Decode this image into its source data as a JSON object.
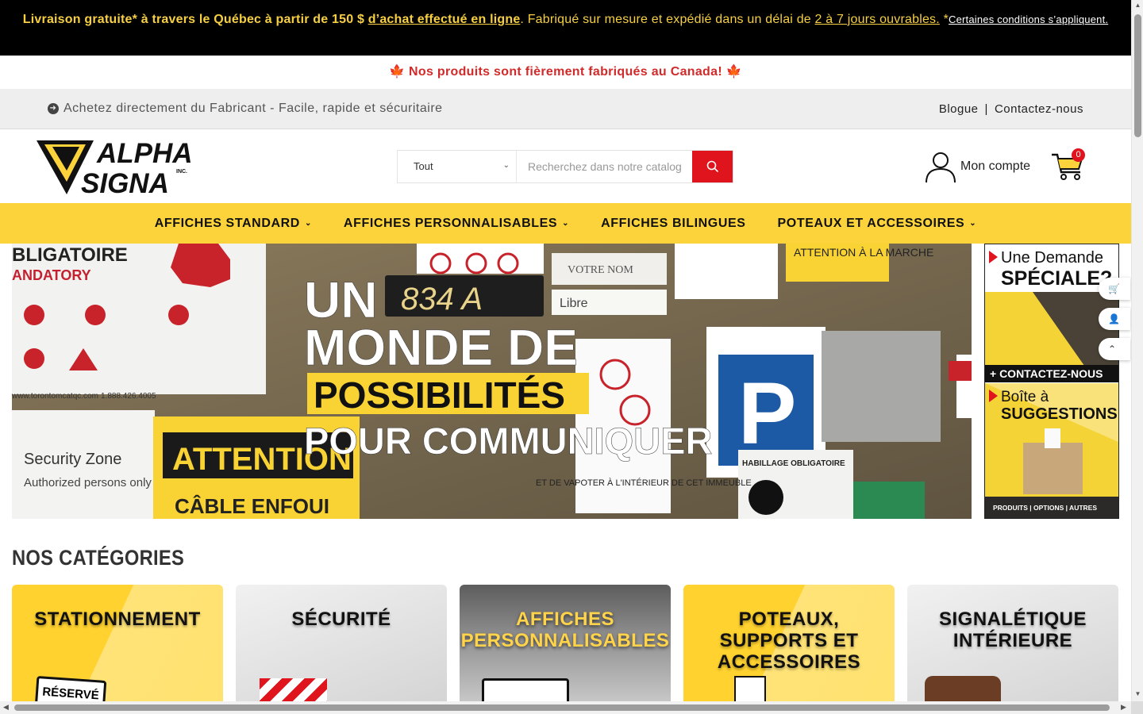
{
  "promo": {
    "part1": "Livraison gratuite* à travers le Québec à partir de 150 $ ",
    "link1": "d’achat effectué en ligne",
    "part2": ". Fabriqué sur mesure et expédié dans un délai de ",
    "link2": "2 à 7 jours ouvrables.",
    "part3": " *",
    "conditions": "Certaines conditions s’appliquent."
  },
  "canada_banner": "🍁 Nos produits sont fièrement fabriqués au Canada! 🍁",
  "utility": {
    "tagline": "Achetez directement du Fabricant - Facile, rapide et sécuritaire",
    "blog": "Blogue",
    "separator": "|",
    "contact": "Contactez-nous"
  },
  "header": {
    "logo_line1": "ALPHA",
    "logo_line2": "SIGNA",
    "logo_inc": "INC.",
    "search_category": "Tout",
    "search_placeholder": "Recherchez dans notre catalogue",
    "account_label": "Mon compte",
    "cart_count": "0"
  },
  "nav": [
    {
      "label": "AFFICHES STANDARD",
      "dropdown": true
    },
    {
      "label": "AFFICHES PERSONNALISABLES",
      "dropdown": true
    },
    {
      "label": "AFFICHES BILINGUES",
      "dropdown": false
    },
    {
      "label": "POTEAUX ET ACCESSOIRES",
      "dropdown": true
    }
  ],
  "hero": {
    "line1": "UN",
    "line2": "MONDE DE",
    "line3": "POSSIBILITÉS",
    "line4": "POUR COMMUNIQUER",
    "bg_left_title": "BLIGATOIRE",
    "bg_left_sub": "ANDATORY",
    "bg_plate": "834 A",
    "bg_name": "VOTRE NOM",
    "bg_libre": "Libre",
    "bg_attention": "ATTENTION",
    "bg_security": "Security Zone",
    "bg_authorized": "Authorized persons only",
    "bg_cable": "CÂBLE ENFOUI",
    "bg_url": "www.torontomcatqc.com",
    "bg_phone": "1.888.426.4005",
    "bg_attention_marche": "ATTENTION À LA MARCHE",
    "bg_habillage": "HABILLAGE OBLIGATOIRE",
    "bg_immeuble": "ET DE VAPOTER À L'INTÉRIEUR DE CET IMMEUBLE",
    "bg_p": "P"
  },
  "side_ad": {
    "demande_line1": "Une Demande",
    "demande_line2": "SPÉCIALE?",
    "contact_cta": "+ CONTACTEZ-NOUS",
    "boite_line1": "Boîte à",
    "boite_line2": "SUGGESTIONS",
    "footer": "PRODUITS  |  OPTIONS  |  AUTRES"
  },
  "categories_title": "NOS CATÉGORIES",
  "categories": [
    {
      "label": "STATIONNEMENT",
      "style": "yellow",
      "sample": "RÉSERVÉ"
    },
    {
      "label": "SÉCURITÉ",
      "style": "gray"
    },
    {
      "label": "AFFICHES PERSONNALISABLES",
      "style": "metal"
    },
    {
      "label": "POTEAUX, SUPPORTS ET ACCESSOIRES",
      "style": "yellow"
    },
    {
      "label": "SIGNALÉTIQUE INTÉRIEURE",
      "style": "gray"
    }
  ],
  "colors": {
    "brand_yellow": "#fdd33b",
    "brand_red": "#e0141d",
    "promo_text": "#f6cf43",
    "canada_red": "#d12a2a"
  },
  "icons": {
    "search": "search-icon",
    "account": "user-icon",
    "cart": "cart-icon",
    "float_cart": "cart-icon",
    "float_user": "user-icon",
    "float_top": "chevron-up-icon"
  }
}
